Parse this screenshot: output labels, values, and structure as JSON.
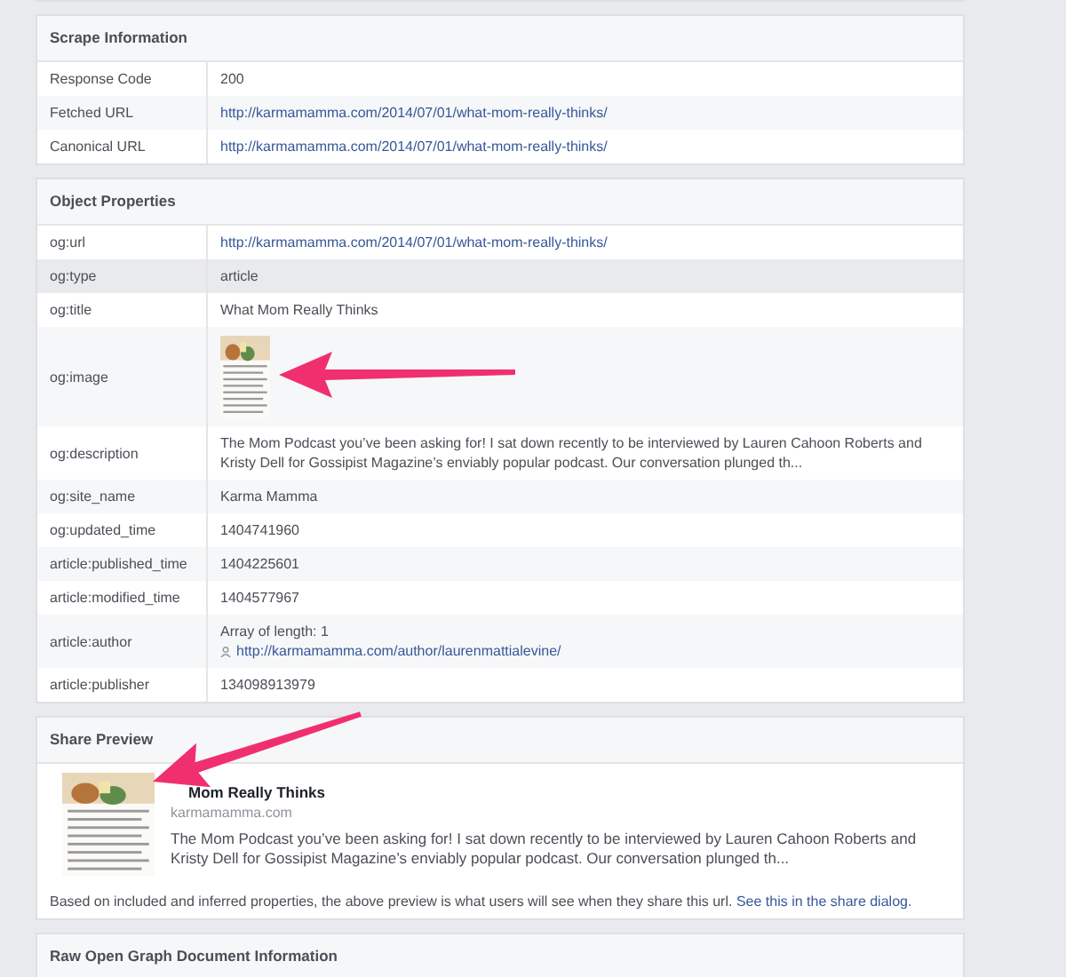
{
  "scrape_information": {
    "title": "Scrape Information",
    "rows": [
      {
        "label": "Response Code",
        "kind": "text",
        "value": "200",
        "hovered": false
      },
      {
        "label": "Fetched URL",
        "kind": "link",
        "value": "http://karmamamma.com/2014/07/01/what-mom-really-thinks/",
        "hovered": false
      },
      {
        "label": "Canonical URL",
        "kind": "link",
        "value": "http://karmamamma.com/2014/07/01/what-mom-really-thinks/",
        "hovered": false
      }
    ]
  },
  "object_properties": {
    "title": "Object Properties",
    "rows": [
      {
        "label": "og:url",
        "kind": "link",
        "value": "http://karmamamma.com/2014/07/01/what-mom-really-thinks/",
        "hovered": false
      },
      {
        "label": "og:type",
        "kind": "text",
        "value": "article",
        "hovered": true
      },
      {
        "label": "og:title",
        "kind": "text",
        "value": "What Mom Really Thinks",
        "hovered": false
      },
      {
        "label": "og:image",
        "hovered": false
      },
      {
        "label": "og:description",
        "kind": "text",
        "value": "The Mom Podcast you’ve been asking for! I sat down recently to be interviewed by Lauren Cahoon Roberts and Kristy Dell for Gossipist Magazine’s enviably popular podcast. Our conversation plunged th...",
        "hovered": false
      },
      {
        "label": "og:site_name",
        "kind": "text",
        "value": "Karma Mamma",
        "hovered": false
      },
      {
        "label": "og:updated_time",
        "kind": "text",
        "value": "1404741960",
        "hovered": false
      },
      {
        "label": "article:published_time",
        "kind": "text",
        "value": "1404225601",
        "hovered": false
      },
      {
        "label": "article:modified_time",
        "kind": "text",
        "value": "1404577967",
        "hovered": false
      },
      {
        "label": "article:author",
        "kind": "array",
        "value": "Array of length: 1",
        "link": "http://karmamamma.com/author/laurenmattialevine/",
        "hovered": false
      },
      {
        "label": "article:publisher",
        "kind": "text",
        "value": "134098913979",
        "hovered": false
      }
    ]
  },
  "share_preview": {
    "title": "Share Preview",
    "preview_title": "Mom Really Thinks",
    "domain": "karmamamma.com",
    "description": "The Mom Podcast you’ve been asking for! I sat down recently to be interviewed by Lauren Cahoon Roberts and Kristy Dell for Gossipist Magazine’s enviably popular podcast. Our conversation plunged th...",
    "note": "Based on included and inferred properties, the above preview is what users will see when they share this url.",
    "note_link": "See this in the share dialog."
  },
  "raw_section": {
    "title": "Raw Open Graph Document Information"
  }
}
